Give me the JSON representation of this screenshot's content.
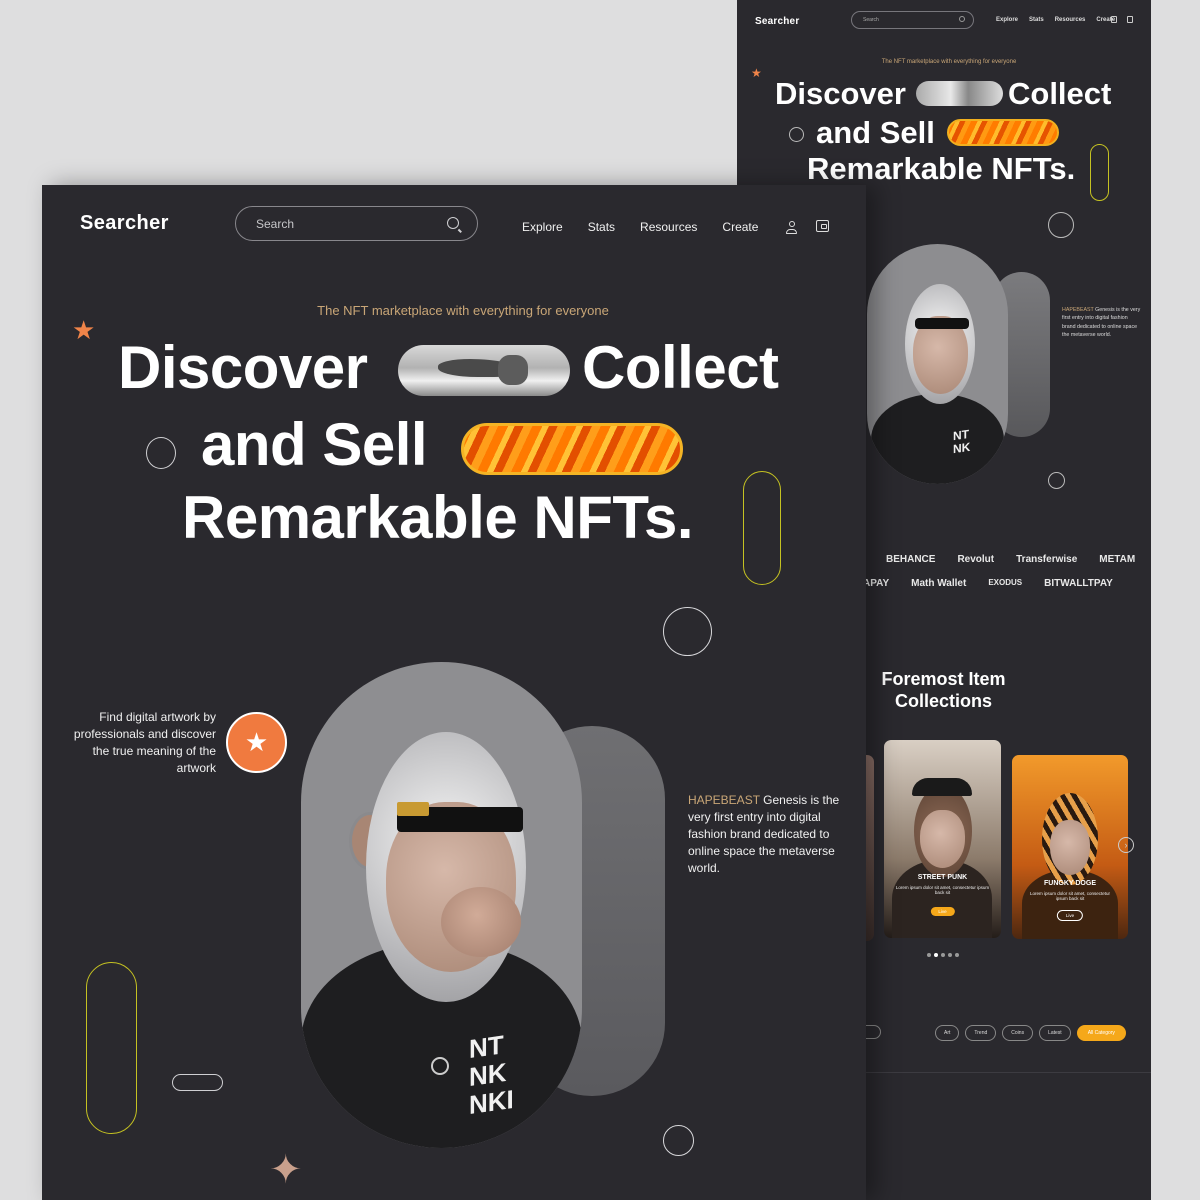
{
  "brand": "Searcher",
  "colors": {
    "background": "#2a292e",
    "accent_orange": "#f07a3f",
    "accent_gold": "#c9a677",
    "accent_yellow": "#c5c222",
    "canvas": "#dededf"
  },
  "search": {
    "placeholder": "Search",
    "icon": "search-icon"
  },
  "nav": {
    "items": [
      "Explore",
      "Stats",
      "Resources",
      "Create"
    ],
    "icons": [
      "user-icon",
      "wallet-icon"
    ]
  },
  "hero": {
    "tagline": "The NFT marketplace with everything for everyone",
    "line1a": "Discover",
    "line1b": "Collect",
    "line2": "and Sell",
    "line3": "Remarkable NFTs."
  },
  "find_text": "Find digital artwork by professionals and discover the true meaning of the artwork",
  "hapebeast": {
    "accent": "HAPEBEAST",
    "rest": " Genesis is the very first entry into digital fashion brand dedicated to online space the metaverse world."
  },
  "jacket_text": [
    "NT",
    "NK",
    "NKI"
  ],
  "brands": {
    "row1": [
      "BEHANCE",
      "Revolut",
      "Transferwise",
      "METAM"
    ],
    "row2": [
      "APAY",
      "Math Wallet",
      "EXODUS",
      "BITWALLTPAY"
    ]
  },
  "collections": {
    "title_line1": "Foremost Item",
    "title_line2": "Collections",
    "cards": [
      {
        "title": "STREET PUNK",
        "subtitle": "Lorem ipsum dolor sit amet, consectetur ipsum back sit",
        "button": "Live"
      },
      {
        "title": "FUNGKY DOGE",
        "subtitle": "Lorem ipsum dolor sit amet, consectetur ipsum back sit",
        "button": "Live"
      }
    ],
    "next_arrow": "›"
  },
  "filters": {
    "chips": [
      "Art",
      "Trend",
      "Coins",
      "Latest",
      "All Category"
    ],
    "selected": "All Category"
  }
}
